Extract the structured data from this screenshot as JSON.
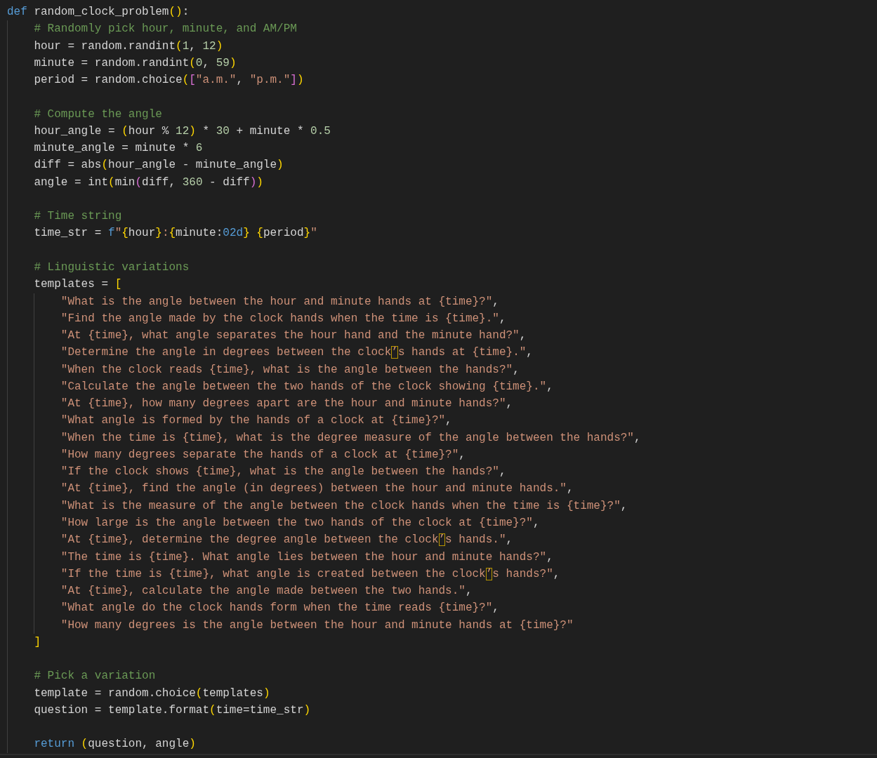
{
  "editor": {
    "lines": [
      {
        "kind": "code",
        "tokens": [
          {
            "kind": "keyword",
            "text": "def"
          },
          {
            "kind": "plain",
            "text": " random_clock_problem"
          },
          {
            "kind": "bracket1",
            "text": "()"
          },
          {
            "kind": "plain",
            "text": ":"
          }
        ],
        "children": [
          {
            "kind": "code",
            "tokens": [
              {
                "kind": "comment",
                "text": "# Randomly pick hour, minute, and AM/PM"
              }
            ]
          },
          {
            "kind": "code",
            "tokens": [
              {
                "kind": "plain",
                "text": "hour = random.randint"
              },
              {
                "kind": "bracket1",
                "text": "("
              },
              {
                "kind": "number",
                "text": "1"
              },
              {
                "kind": "plain",
                "text": ", "
              },
              {
                "kind": "number",
                "text": "12"
              },
              {
                "kind": "bracket1",
                "text": ")"
              }
            ]
          },
          {
            "kind": "code",
            "tokens": [
              {
                "kind": "plain",
                "text": "minute = random.randint"
              },
              {
                "kind": "bracket1",
                "text": "("
              },
              {
                "kind": "number",
                "text": "0"
              },
              {
                "kind": "plain",
                "text": ", "
              },
              {
                "kind": "number",
                "text": "59"
              },
              {
                "kind": "bracket1",
                "text": ")"
              }
            ]
          },
          {
            "kind": "code",
            "tokens": [
              {
                "kind": "plain",
                "text": "period = random.choice"
              },
              {
                "kind": "bracket1",
                "text": "("
              },
              {
                "kind": "bracket2",
                "text": "["
              },
              {
                "kind": "string",
                "text": "\"a.m.\""
              },
              {
                "kind": "plain",
                "text": ", "
              },
              {
                "kind": "string",
                "text": "\"p.m.\""
              },
              {
                "kind": "bracket2",
                "text": "]"
              },
              {
                "kind": "bracket1",
                "text": ")"
              }
            ]
          },
          {
            "kind": "blank"
          },
          {
            "kind": "code",
            "tokens": [
              {
                "kind": "comment",
                "text": "# Compute the angle"
              }
            ]
          },
          {
            "kind": "code",
            "tokens": [
              {
                "kind": "plain",
                "text": "hour_angle = "
              },
              {
                "kind": "bracket1",
                "text": "("
              },
              {
                "kind": "plain",
                "text": "hour % "
              },
              {
                "kind": "number",
                "text": "12"
              },
              {
                "kind": "bracket1",
                "text": ")"
              },
              {
                "kind": "plain",
                "text": " * "
              },
              {
                "kind": "number",
                "text": "30"
              },
              {
                "kind": "plain",
                "text": " + minute * "
              },
              {
                "kind": "number",
                "text": "0.5"
              }
            ]
          },
          {
            "kind": "code",
            "tokens": [
              {
                "kind": "plain",
                "text": "minute_angle = minute * "
              },
              {
                "kind": "number",
                "text": "6"
              }
            ]
          },
          {
            "kind": "code",
            "tokens": [
              {
                "kind": "plain",
                "text": "diff = abs"
              },
              {
                "kind": "bracket1",
                "text": "("
              },
              {
                "kind": "plain",
                "text": "hour_angle - minute_angle"
              },
              {
                "kind": "bracket1",
                "text": ")"
              }
            ]
          },
          {
            "kind": "code",
            "tokens": [
              {
                "kind": "plain",
                "text": "angle = int"
              },
              {
                "kind": "bracket1",
                "text": "("
              },
              {
                "kind": "plain",
                "text": "min"
              },
              {
                "kind": "bracket2",
                "text": "("
              },
              {
                "kind": "plain",
                "text": "diff, "
              },
              {
                "kind": "number",
                "text": "360"
              },
              {
                "kind": "plain",
                "text": " - diff"
              },
              {
                "kind": "bracket2",
                "text": ")"
              },
              {
                "kind": "bracket1",
                "text": ")"
              }
            ]
          },
          {
            "kind": "blank"
          },
          {
            "kind": "code",
            "tokens": [
              {
                "kind": "comment",
                "text": "# Time string"
              }
            ]
          },
          {
            "kind": "code",
            "tokens": [
              {
                "kind": "plain",
                "text": "time_str = "
              },
              {
                "kind": "keyword",
                "text": "f"
              },
              {
                "kind": "string",
                "text": "\""
              },
              {
                "kind": "bracket1",
                "text": "{"
              },
              {
                "kind": "plain",
                "text": "hour"
              },
              {
                "kind": "bracket1",
                "text": "}"
              },
              {
                "kind": "string",
                "text": ":"
              },
              {
                "kind": "bracket1",
                "text": "{"
              },
              {
                "kind": "plain",
                "text": "minute:"
              },
              {
                "kind": "keyword",
                "text": "02d"
              },
              {
                "kind": "bracket1",
                "text": "} {"
              },
              {
                "kind": "plain",
                "text": "period"
              },
              {
                "kind": "bracket1",
                "text": "}"
              },
              {
                "kind": "string",
                "text": "\""
              }
            ]
          },
          {
            "kind": "blank"
          },
          {
            "kind": "code",
            "tokens": [
              {
                "kind": "comment",
                "text": "# Linguistic variations"
              }
            ]
          },
          {
            "kind": "code",
            "tokens": [
              {
                "kind": "plain",
                "text": "templates = "
              },
              {
                "kind": "bracket1",
                "text": "["
              }
            ],
            "children": [
              {
                "kind": "code",
                "tokens": [
                  {
                    "kind": "string",
                    "text": "\"What is the angle between the hour and minute hands at {time}?\""
                  },
                  {
                    "kind": "plain",
                    "text": ","
                  }
                ]
              },
              {
                "kind": "code",
                "tokens": [
                  {
                    "kind": "string",
                    "text": "\"Find the angle made by the clock hands when the time is {time}.\""
                  },
                  {
                    "kind": "plain",
                    "text": ","
                  }
                ]
              },
              {
                "kind": "code",
                "tokens": [
                  {
                    "kind": "string",
                    "text": "\"At {time}, what angle separates the hour hand and the minute hand?\""
                  },
                  {
                    "kind": "plain",
                    "text": ","
                  }
                ]
              },
              {
                "kind": "code",
                "tokens": [
                  {
                    "kind": "string",
                    "text": "\"Determine the angle in degrees between the clock"
                  },
                  {
                    "kind": "flagged",
                    "text": "’"
                  },
                  {
                    "kind": "string",
                    "text": "s hands at {time}.\""
                  },
                  {
                    "kind": "plain",
                    "text": ","
                  }
                ]
              },
              {
                "kind": "code",
                "tokens": [
                  {
                    "kind": "string",
                    "text": "\"When the clock reads {time}, what is the angle between the hands?\""
                  },
                  {
                    "kind": "plain",
                    "text": ","
                  }
                ]
              },
              {
                "kind": "code",
                "tokens": [
                  {
                    "kind": "string",
                    "text": "\"Calculate the angle between the two hands of the clock showing {time}.\""
                  },
                  {
                    "kind": "plain",
                    "text": ","
                  }
                ]
              },
              {
                "kind": "code",
                "tokens": [
                  {
                    "kind": "string",
                    "text": "\"At {time}, how many degrees apart are the hour and minute hands?\""
                  },
                  {
                    "kind": "plain",
                    "text": ","
                  }
                ]
              },
              {
                "kind": "code",
                "tokens": [
                  {
                    "kind": "string",
                    "text": "\"What angle is formed by the hands of a clock at {time}?\""
                  },
                  {
                    "kind": "plain",
                    "text": ","
                  }
                ]
              },
              {
                "kind": "code",
                "tokens": [
                  {
                    "kind": "string",
                    "text": "\"When the time is {time}, what is the degree measure of the angle between the hands?\""
                  },
                  {
                    "kind": "plain",
                    "text": ","
                  }
                ]
              },
              {
                "kind": "code",
                "tokens": [
                  {
                    "kind": "string",
                    "text": "\"How many degrees separate the hands of a clock at {time}?\""
                  },
                  {
                    "kind": "plain",
                    "text": ","
                  }
                ]
              },
              {
                "kind": "code",
                "tokens": [
                  {
                    "kind": "string",
                    "text": "\"If the clock shows {time}, what is the angle between the hands?\""
                  },
                  {
                    "kind": "plain",
                    "text": ","
                  }
                ]
              },
              {
                "kind": "code",
                "tokens": [
                  {
                    "kind": "string",
                    "text": "\"At {time}, find the angle (in degrees) between the hour and minute hands.\""
                  },
                  {
                    "kind": "plain",
                    "text": ","
                  }
                ]
              },
              {
                "kind": "code",
                "tokens": [
                  {
                    "kind": "string",
                    "text": "\"What is the measure of the angle between the clock hands when the time is {time}?\""
                  },
                  {
                    "kind": "plain",
                    "text": ","
                  }
                ]
              },
              {
                "kind": "code",
                "tokens": [
                  {
                    "kind": "string",
                    "text": "\"How large is the angle between the two hands of the clock at {time}?\""
                  },
                  {
                    "kind": "plain",
                    "text": ","
                  }
                ]
              },
              {
                "kind": "code",
                "tokens": [
                  {
                    "kind": "string",
                    "text": "\"At {time}, determine the degree angle between the clock"
                  },
                  {
                    "kind": "flagged",
                    "text": "’"
                  },
                  {
                    "kind": "string",
                    "text": "s hands.\""
                  },
                  {
                    "kind": "plain",
                    "text": ","
                  }
                ]
              },
              {
                "kind": "code",
                "tokens": [
                  {
                    "kind": "string",
                    "text": "\"The time is {time}. What angle lies between the hour and minute hands?\""
                  },
                  {
                    "kind": "plain",
                    "text": ","
                  }
                ]
              },
              {
                "kind": "code",
                "tokens": [
                  {
                    "kind": "string",
                    "text": "\"If the time is {time}, what angle is created between the clock"
                  },
                  {
                    "kind": "flagged",
                    "text": "’"
                  },
                  {
                    "kind": "string",
                    "text": "s hands?\""
                  },
                  {
                    "kind": "plain",
                    "text": ","
                  }
                ]
              },
              {
                "kind": "code",
                "tokens": [
                  {
                    "kind": "string",
                    "text": "\"At {time}, calculate the angle made between the two hands.\""
                  },
                  {
                    "kind": "plain",
                    "text": ","
                  }
                ]
              },
              {
                "kind": "code",
                "tokens": [
                  {
                    "kind": "string",
                    "text": "\"What angle do the clock hands form when the time reads {time}?\""
                  },
                  {
                    "kind": "plain",
                    "text": ","
                  }
                ]
              },
              {
                "kind": "code",
                "tokens": [
                  {
                    "kind": "string",
                    "text": "\"How many degrees is the angle between the hour and minute hands at {time}?\""
                  }
                ]
              }
            ]
          },
          {
            "kind": "code",
            "tokens": [
              {
                "kind": "bracket1",
                "text": "]"
              }
            ]
          },
          {
            "kind": "blank"
          },
          {
            "kind": "code",
            "tokens": [
              {
                "kind": "comment",
                "text": "# Pick a variation"
              }
            ]
          },
          {
            "kind": "code",
            "tokens": [
              {
                "kind": "plain",
                "text": "template = random.choice"
              },
              {
                "kind": "bracket1",
                "text": "("
              },
              {
                "kind": "plain",
                "text": "templates"
              },
              {
                "kind": "bracket1",
                "text": ")"
              }
            ]
          },
          {
            "kind": "code",
            "tokens": [
              {
                "kind": "plain",
                "text": "question = template.format"
              },
              {
                "kind": "bracket1",
                "text": "("
              },
              {
                "kind": "plain",
                "text": "time=time_str"
              },
              {
                "kind": "bracket1",
                "text": ")"
              }
            ]
          },
          {
            "kind": "blank"
          },
          {
            "kind": "code",
            "tokens": [
              {
                "kind": "keyword",
                "text": "return"
              },
              {
                "kind": "bracket1",
                "text": " ("
              },
              {
                "kind": "plain",
                "text": "question, angle"
              },
              {
                "kind": "bracket1",
                "text": ")"
              }
            ]
          }
        ]
      }
    ]
  }
}
